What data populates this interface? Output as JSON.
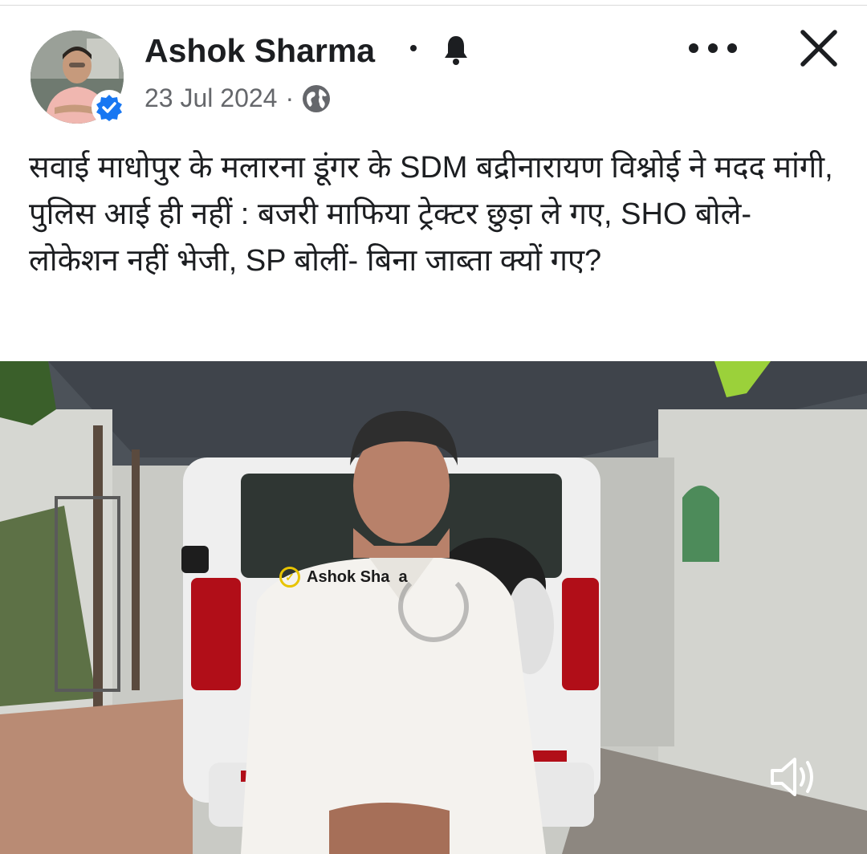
{
  "post": {
    "author": "Ashok Sharma",
    "separator_dot": "•",
    "date": "23 Jul 2024",
    "date_separator": "·",
    "text": "सवाई माधोपुर के मलारना डूंगर के SDM बद्रीनारायण विश्नोई ने मदद मांगी, पुलिस आई ही नहीं : बजरी माफिया ट्रेक्टर छुड़ा ले गए, SHO बोले- लोकेशन नहीं भेजी, SP बोलीं- बिना जाब्ता क्यों गए?"
  },
  "icons": {
    "verified": "verified-badge-icon",
    "bell": "bell-icon",
    "globe": "globe-icon",
    "more": "more-options-icon",
    "close": "close-icon",
    "volume": "volume-icon",
    "spinner": "loading-spinner-icon"
  },
  "video": {
    "watermark": "Ashok Sha  a"
  },
  "colors": {
    "verified": "#1877f2",
    "text": "#1c1e21",
    "meta": "#65676b"
  }
}
